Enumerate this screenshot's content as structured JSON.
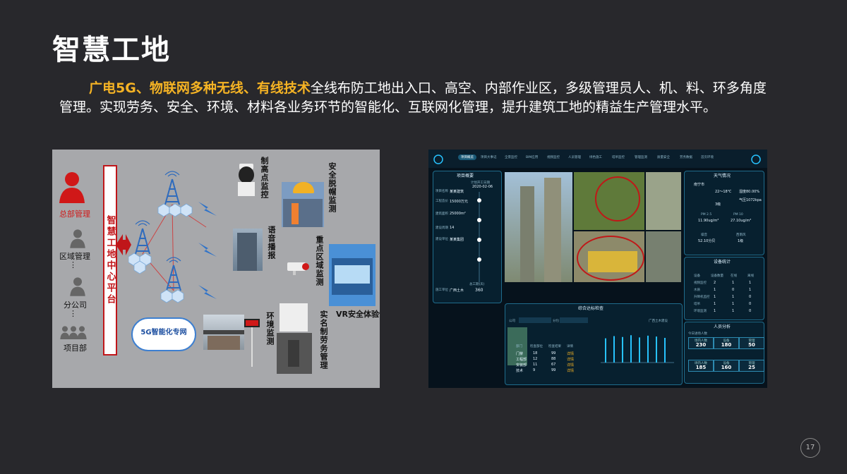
{
  "slide": {
    "title": "智慧工地",
    "highlight": "广电5G、物联网多种无线、有线技术",
    "body": "全线布防工地出入口、高空、内部作业区，多级管理员人、机、料、环多角度管理。实现劳务、安全、环境、材料各业务环节的智能化、互联网化管理，提升建筑工地的精益生产管理水平。",
    "page_number": "17"
  },
  "diagram": {
    "roles": [
      "总部管理",
      "区域管理",
      "分公司",
      "项目部"
    ],
    "platform": "智慧工地中心平台",
    "cloud": "5G智能化专网",
    "monitors": {
      "high_point": "制高点监控",
      "voice": "语音播报",
      "helmet": "安全脱帽监测",
      "key_area": "重点区域监测",
      "vr": "VR安全体验馆",
      "environment": "环境监测",
      "labor": "实名制劳务管理"
    },
    "colors": {
      "red": "#c0161a",
      "tower": "#2e6bbd",
      "hex": "#cfe3f7",
      "bolt": "#2f73c9"
    }
  },
  "dashboard": {
    "nav": [
      "项目概览",
      "项目大事记",
      "全景监控",
      "BIM应用",
      "视频监控",
      "人员管理",
      "绿色施工",
      "塔吊监控",
      "管理监测",
      "质量安全",
      "劳务数据",
      "首页环境"
    ],
    "project_panel": {
      "title": "项目概要",
      "fields": [
        "项目名称",
        "工程造价",
        "建筑面积",
        "建设周期",
        "建设单位",
        "施工单位"
      ],
      "values": [
        "某某建筑",
        "15000万元",
        "25000m²",
        "14",
        "某某集团",
        "广西土木"
      ],
      "timeline_start": "计划开工日期",
      "timeline_date": "2020-02-06",
      "total_days_label": "总工期(天)",
      "total_days": "360"
    },
    "weather_panel": {
      "title": "天气情况",
      "city": "南宁市",
      "temp": "22～18℃",
      "humidity": "湿度80.00%",
      "pressure": "气压1072kpa",
      "wind": "3级",
      "pm25_label": "PM 2.5",
      "pm25": "11.90ug/m³",
      "pm10_label": "PM 10",
      "pm10": "27.10ug/m³",
      "noise_label": "噪音",
      "noise": "52.10分贝",
      "wind2_label": "西南风",
      "wind2": "1级"
    },
    "device_panel": {
      "title": "设备统计",
      "headers": [
        "设备",
        "设备数量",
        "在线",
        "离线"
      ],
      "rows": [
        [
          "视频监控",
          "2",
          "1",
          "1"
        ],
        [
          "水质",
          "1",
          "0",
          "1"
        ],
        [
          "升降机监控",
          "1",
          "1",
          "0"
        ],
        [
          "塔吊",
          "1",
          "1",
          "0"
        ],
        [
          "环境监测",
          "1",
          "1",
          "0"
        ]
      ]
    },
    "people_panel": {
      "title": "人员分析",
      "subtitle": "今日进场人数",
      "row1": [
        {
          "label": "场内人数",
          "value": "230"
        },
        {
          "label": "设备",
          "value": "180"
        },
        {
          "label": "管理",
          "value": "50"
        }
      ],
      "row2": [
        {
          "label": "场内人数",
          "value": "185"
        },
        {
          "label": "设备",
          "value": "160"
        },
        {
          "label": "管理",
          "value": "25"
        }
      ]
    },
    "inspection_panel": {
      "title": "综合达标检查",
      "company_label": "公司",
      "company_value": "广西土木建设",
      "dept_label": "分包",
      "table_headers": [
        "部门",
        "检查部位",
        "检查结果",
        "详情"
      ],
      "table_rows": [
        [
          "门禁",
          "18",
          "99",
          "详情"
        ],
        [
          "工程部",
          "12",
          "88",
          "详情"
        ],
        [
          "安装部",
          "11",
          "67",
          "详情"
        ],
        [
          "技术",
          "9",
          "99",
          "详情"
        ]
      ],
      "right_note": "广西土木建设"
    },
    "chart_data": {
      "type": "bar",
      "values": [
        55,
        60,
        58,
        62,
        57,
        61,
        59,
        56
      ],
      "ylim": [
        0,
        80
      ]
    },
    "colors": {
      "bg": "#06121c",
      "accent": "#1f6c8c",
      "cyan": "#27c3ff"
    }
  }
}
